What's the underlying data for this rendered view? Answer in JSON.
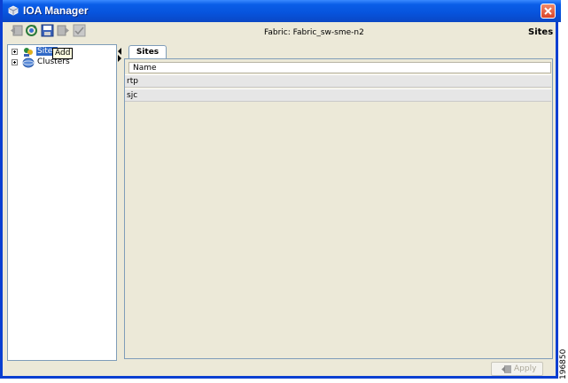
{
  "window": {
    "title": "IOA Manager"
  },
  "header": {
    "fabric_label": "Fabric: Fabric_sw-sme-n2",
    "section_title": "Sites"
  },
  "toolbar": {
    "icons": [
      "back-icon",
      "refresh-icon",
      "save-icon",
      "forward-icon",
      "checklist-icon"
    ]
  },
  "tree": {
    "items": [
      {
        "label": "Sites",
        "selected": true,
        "icon": "sites-icon"
      },
      {
        "label": "Clusters",
        "selected": false,
        "icon": "clusters-icon"
      }
    ],
    "tooltip": "Add"
  },
  "tabs": [
    {
      "label": "Sites"
    }
  ],
  "table": {
    "columns": [
      "Name"
    ],
    "rows": [
      {
        "name": "rtp"
      },
      {
        "name": "sjc"
      }
    ]
  },
  "footer": {
    "apply_label": "Apply"
  },
  "figure_id": "196850",
  "colors": {
    "titlebar": "#0753dc",
    "selection": "#3169c6",
    "window_bg": "#ece9d8"
  }
}
